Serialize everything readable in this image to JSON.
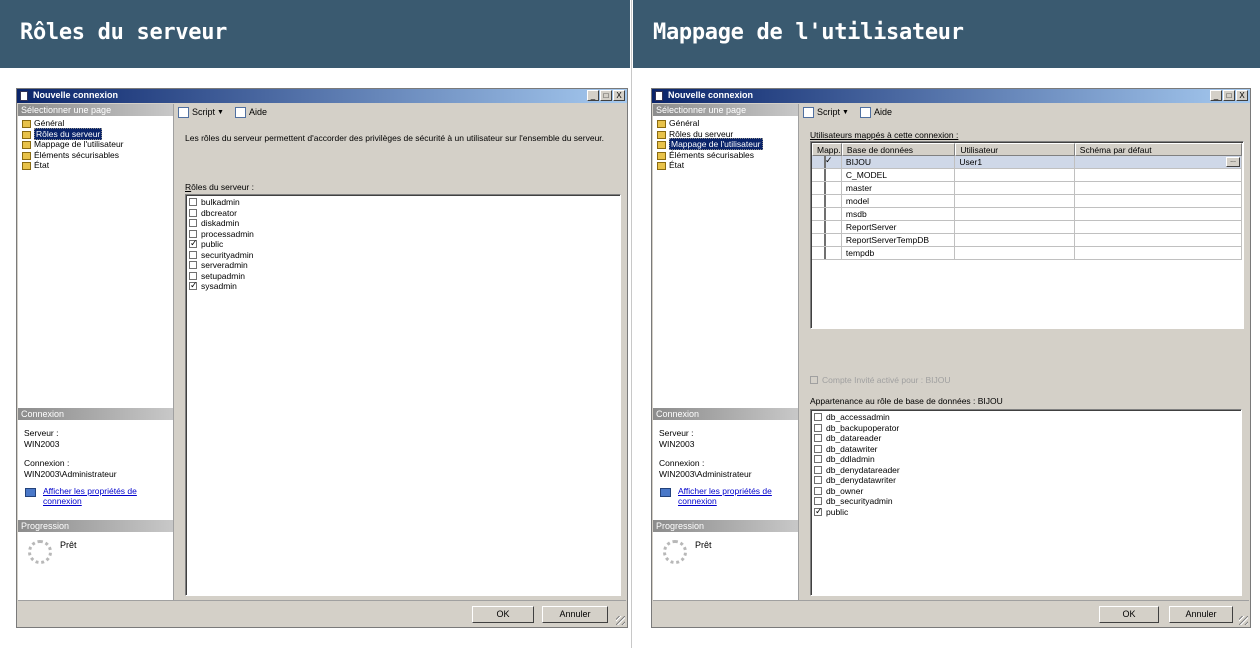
{
  "panels": {
    "left": {
      "heading": "Rôles du serveur",
      "window_title": "Nouvelle connexion",
      "win_buttons": [
        "_",
        "□",
        "X"
      ],
      "select_page": "Sélectionner une page",
      "pages": [
        "Général",
        "Rôles du serveur",
        "Mappage de l'utilisateur",
        "Éléments sécurisables",
        "État"
      ],
      "selected_page_index": 1,
      "connection_header": "Connexion",
      "server_label": "Serveur :",
      "server_value": "WIN2003",
      "connection_label": "Connexion :",
      "connection_value": "WIN2003\\Administrateur",
      "link_line1": "Afficher les propriétés de",
      "link_line2": "connexion",
      "progress_header": "Progression",
      "progress_status": "Prêt",
      "toolbar": {
        "script": "Script",
        "help": "Aide"
      },
      "description": "Les rôles du serveur permettent d'accorder des privilèges de sécurité à un utilisateur sur l'ensemble du serveur.",
      "roles_caption_first": "R",
      "roles_caption_rest": "ôles du serveur :",
      "roles": [
        {
          "name": "bulkadmin",
          "checked": false
        },
        {
          "name": "dbcreator",
          "checked": false
        },
        {
          "name": "diskadmin",
          "checked": false
        },
        {
          "name": "processadmin",
          "checked": false
        },
        {
          "name": "public",
          "checked": true
        },
        {
          "name": "securityadmin",
          "checked": false
        },
        {
          "name": "serveradmin",
          "checked": false
        },
        {
          "name": "setupadmin",
          "checked": false
        },
        {
          "name": "sysadmin",
          "checked": true
        }
      ],
      "ok": "OK",
      "cancel": "Annuler"
    },
    "right": {
      "heading": "Mappage de l'utilisateur",
      "window_title": "Nouvelle connexion",
      "win_buttons": [
        "_",
        "□",
        "X"
      ],
      "select_page": "Sélectionner une page",
      "pages": [
        "Général",
        "Rôles du serveur",
        "Mappage de l'utilisateur",
        "Éléments sécurisables",
        "État"
      ],
      "selected_page_index": 2,
      "connection_header": "Connexion",
      "server_label": "Serveur :",
      "server_value": "WIN2003",
      "connection_label": "Connexion :",
      "connection_value": "WIN2003\\Administrateur",
      "link_line1": "Afficher les propriétés de",
      "link_line2": "connexion",
      "progress_header": "Progression",
      "progress_status": "Prêt",
      "toolbar": {
        "script": "Script",
        "help": "Aide"
      },
      "mapped_caption": "Utilisateurs mappés à cette connexion :",
      "grid_headers": {
        "map": "Mapp...",
        "db": "Base de données",
        "user": "Utilisateur",
        "schema": "Schéma par défaut"
      },
      "grid_rows": [
        {
          "db": "BIJOU",
          "user": "User1",
          "schema": "",
          "mapped": true,
          "selected": true
        },
        {
          "db": "C_MODEL",
          "user": "",
          "schema": "",
          "mapped": false,
          "selected": false
        },
        {
          "db": "master",
          "user": "",
          "schema": "",
          "mapped": false,
          "selected": false
        },
        {
          "db": "model",
          "user": "",
          "schema": "",
          "mapped": false,
          "selected": false
        },
        {
          "db": "msdb",
          "user": "",
          "schema": "",
          "mapped": false,
          "selected": false
        },
        {
          "db": "ReportServer",
          "user": "",
          "schema": "",
          "mapped": false,
          "selected": false
        },
        {
          "db": "ReportServerTempDB",
          "user": "",
          "schema": "",
          "mapped": false,
          "selected": false
        },
        {
          "db": "tempdb",
          "user": "",
          "schema": "",
          "mapped": false,
          "selected": false
        }
      ],
      "ellipsis": "...",
      "guest_label": "Compte Invité activé pour : BIJOU",
      "membership_caption": "Appartenance au rôle de base de données : BIJOU",
      "db_roles": [
        {
          "name": "db_accessadmin",
          "checked": false
        },
        {
          "name": "db_backupoperator",
          "checked": false
        },
        {
          "name": "db_datareader",
          "checked": false
        },
        {
          "name": "db_datawriter",
          "checked": false
        },
        {
          "name": "db_ddladmin",
          "checked": false
        },
        {
          "name": "db_denydatareader",
          "checked": false
        },
        {
          "name": "db_denydatawriter",
          "checked": false
        },
        {
          "name": "db_owner",
          "checked": false
        },
        {
          "name": "db_securityadmin",
          "checked": false
        },
        {
          "name": "public",
          "checked": true
        }
      ],
      "ok": "OK",
      "cancel": "Annuler"
    }
  }
}
